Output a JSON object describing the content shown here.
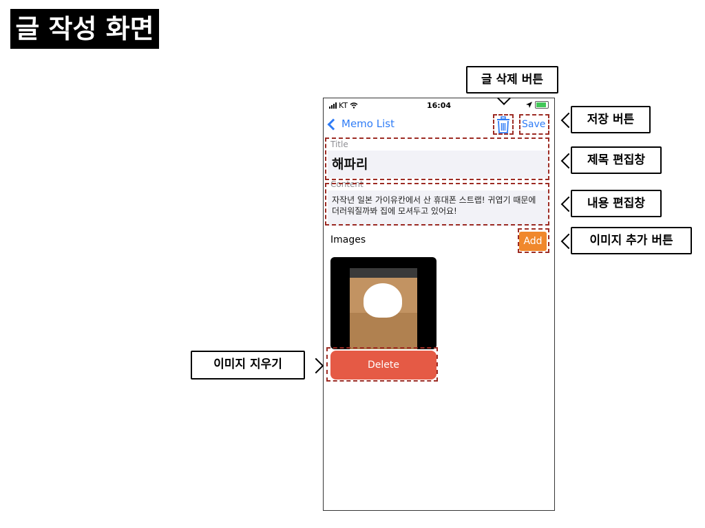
{
  "page_title": "글 작성 화면",
  "phone": {
    "status": {
      "carrier": "KT",
      "time": "16:04"
    },
    "nav": {
      "back_label": "Memo List",
      "save_label": "Save"
    },
    "form": {
      "title_label": "Title",
      "title_value": "해파리",
      "content_label": "Content",
      "content_value": "자작년 일본 가이유칸에서 산 휴대폰 스트랩! 귀엽기 때문에 더러워질까봐 집에 모셔두고 있어요!",
      "images_label": "Images",
      "add_label": "Add",
      "delete_label": "Delete"
    }
  },
  "annotations": {
    "delete_post": "글 삭제 버튼",
    "save": "저장 버튼",
    "title_edit": "제목 편집창",
    "content_edit": "내용 편집창",
    "add_image": "이미지 추가 버튼",
    "remove_image": "이미지 지우기"
  },
  "colors": {
    "accent": "#2f7cf6",
    "add_button": "#f0882c",
    "delete_button": "#e55a45",
    "highlight": "#9c2a22"
  }
}
